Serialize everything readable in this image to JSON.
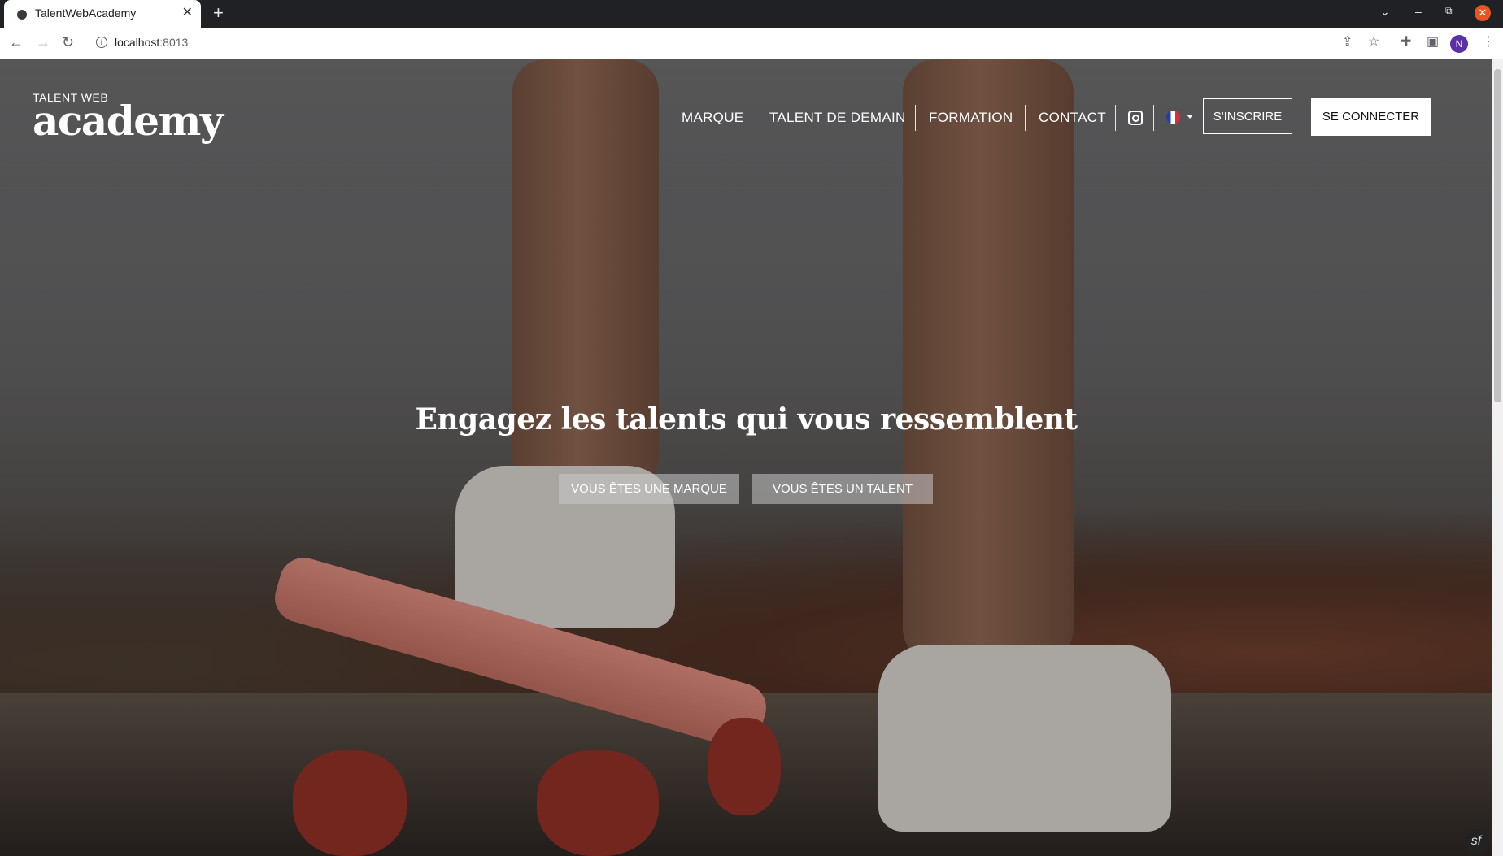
{
  "browser": {
    "tab_title": "TalentWebAcademy",
    "tab_close": "✕",
    "new_tab": "+",
    "url_host": "localhost",
    "url_port": ":8013",
    "avatar_initial": "N",
    "window_controls": {
      "minimize": "–",
      "restore": "⧉",
      "close": "✕",
      "tab_list": "⌄"
    },
    "nav": {
      "back": "←",
      "forward": "→",
      "reload": "↻"
    },
    "toolbar_icons": {
      "share": "⇪",
      "bookmark": "☆",
      "extensions": "✚",
      "sidebar": "▣",
      "menu": "⋮"
    }
  },
  "site": {
    "logo": {
      "small": "TALENT WEB",
      "big": "academy"
    },
    "nav": {
      "items": [
        {
          "label": "MARQUE"
        },
        {
          "label": "TALENT DE DEMAIN"
        },
        {
          "label": "FORMATION"
        },
        {
          "label": "CONTACT"
        }
      ],
      "instagram_icon": "instagram-icon",
      "language": "fr"
    },
    "buttons": {
      "signup": "S'INSCRIRE",
      "login": "SE CONNECTER"
    },
    "hero": {
      "title": "Engagez les talents qui vous ressemblent",
      "cta_brand": "VOUS ÊTES UNE MARQUE",
      "cta_talent": "VOUS ÊTES UN TALENT"
    },
    "debug_badge": "sf"
  },
  "colors": {
    "browser_tabbar": "#202124",
    "close_button": "#e95420",
    "avatar": "#5b2fa6",
    "text_on_hero": "#ffffff"
  }
}
